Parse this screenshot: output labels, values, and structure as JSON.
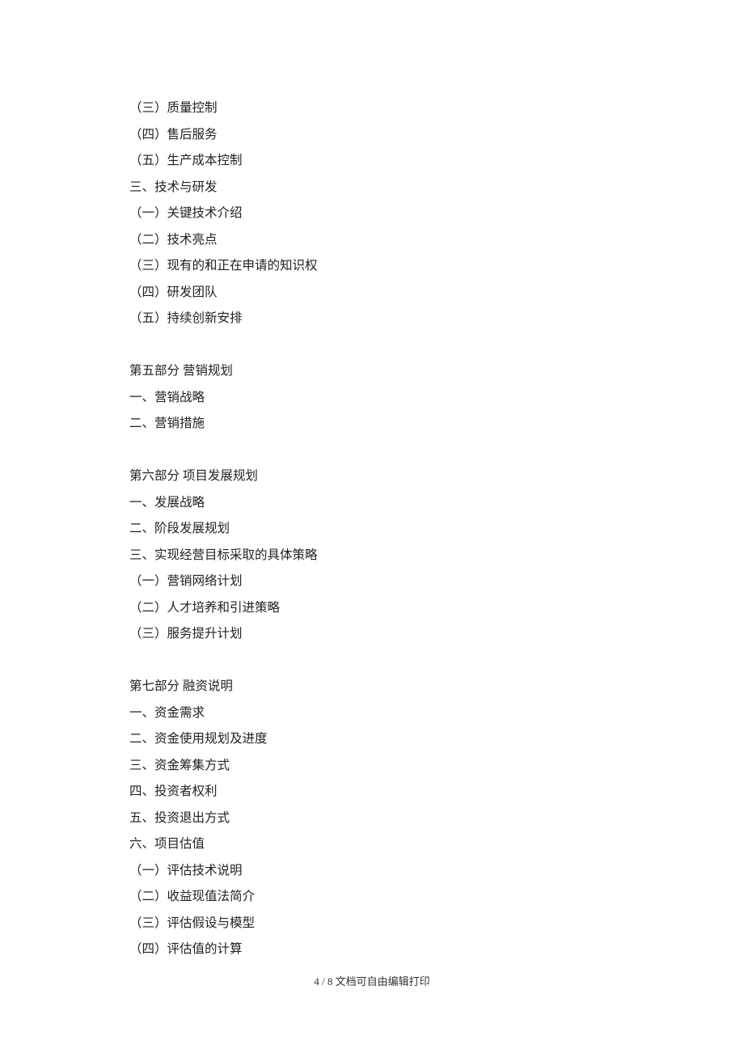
{
  "lines": [
    "（三）质量控制",
    "（四）售后服务",
    "（五）生产成本控制",
    "三、技术与研发",
    "（一）关键技术介绍",
    "（二）技术亮点",
    "（三）现有的和正在申请的知识权",
    "（四）研发团队",
    "（五）持续创新安排",
    "",
    "第五部分  营销规划",
    "一、营销战略",
    "二、营销措施",
    "",
    "第六部分  项目发展规划",
    "一、发展战略",
    "二、阶段发展规划",
    "三、实现经营目标采取的具体策略",
    "（一）营销网络计划",
    "（二）人才培养和引进策略",
    "（三）服务提升计划",
    "",
    "第七部分  融资说明",
    "一、资金需求",
    "二、资金使用规划及进度",
    "三、资金筹集方式",
    "四、投资者权利",
    "五、投资退出方式",
    "六、项目估值",
    "（一）评估技术说明",
    "（二）收益现值法简介",
    "（三）评估假设与模型",
    "（四）评估值的计算"
  ],
  "footer": {
    "page_current": "4",
    "page_total": "8",
    "note": "文档可自由编辑打印"
  }
}
